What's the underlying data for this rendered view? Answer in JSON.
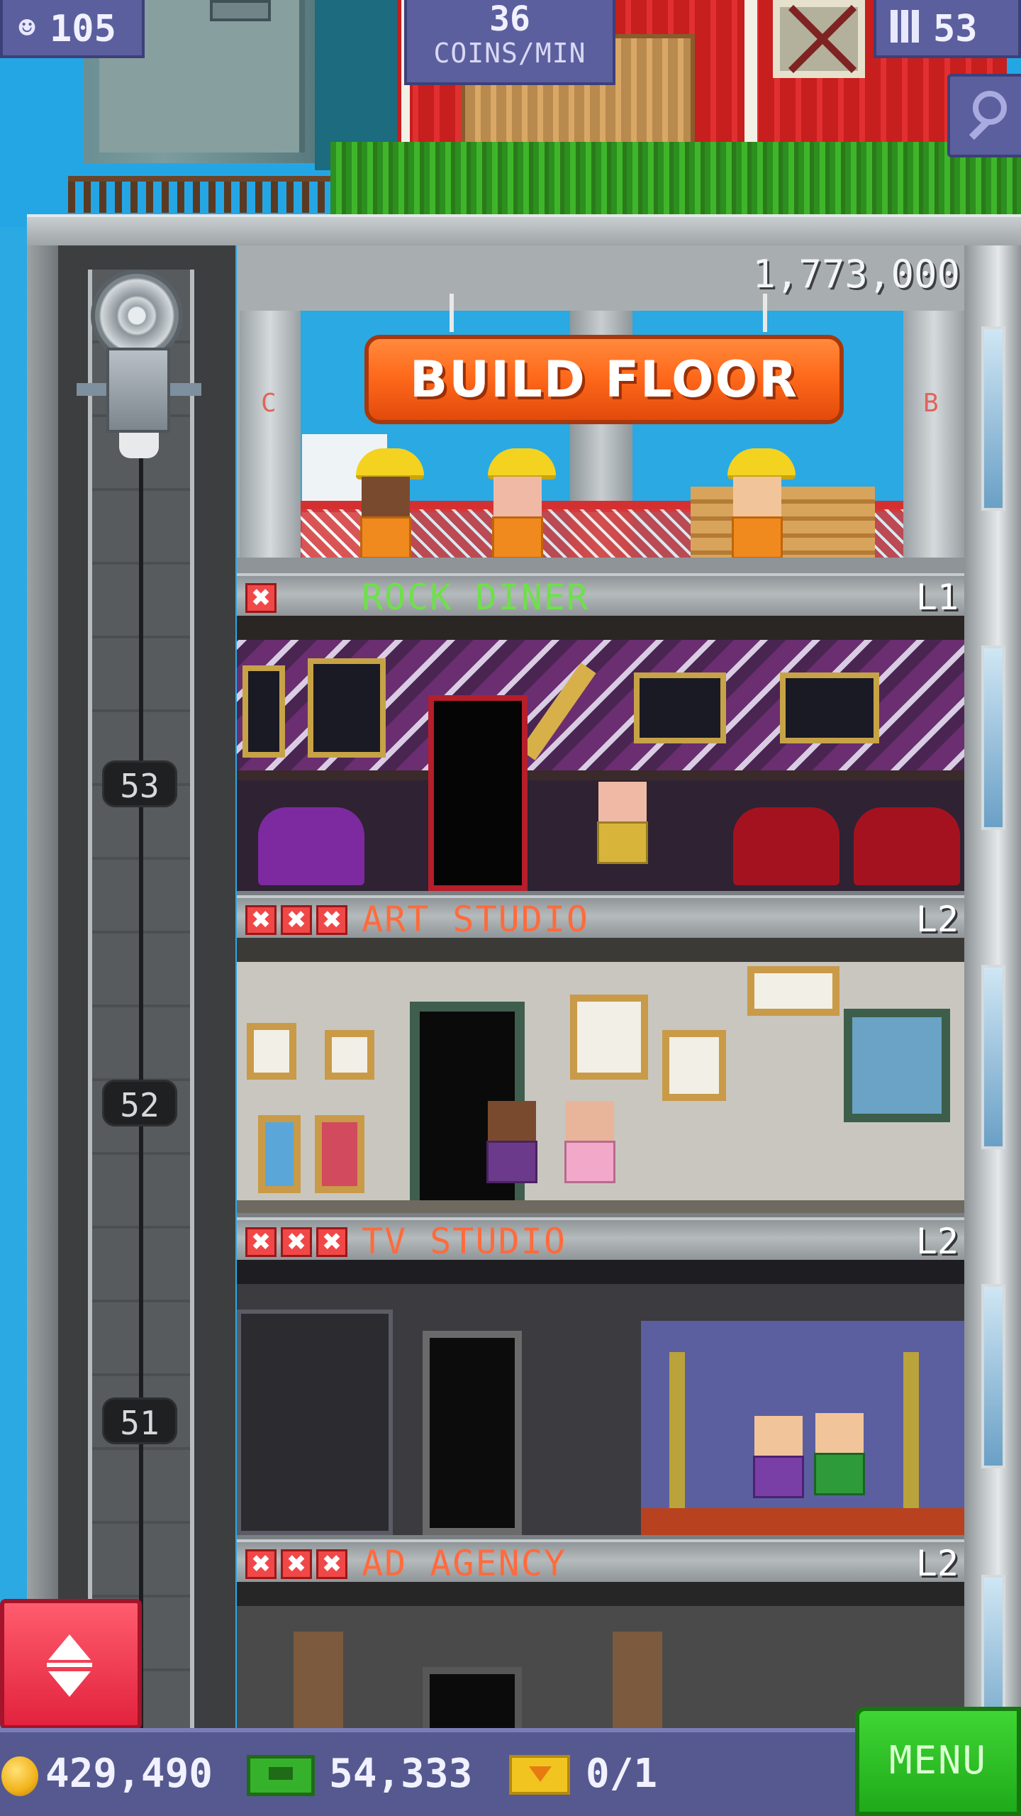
{
  "hud": {
    "population": "105",
    "rate_value": "36",
    "rate_label": "COINS/MIN",
    "floor_count": "53"
  },
  "build": {
    "price": "1,773,000",
    "button_label": "BUILD FLOOR",
    "pillar_left_mark": "C",
    "pillar_right_mark": "B"
  },
  "floors": [
    {
      "name": "ROCK DINER",
      "level": "L1",
      "stock_missing": 1,
      "color": "#6ee04a"
    },
    {
      "name": "ART STUDIO",
      "level": "L2",
      "stock_missing": 3,
      "color": "#ff6b3d"
    },
    {
      "name": "TV STUDIO",
      "level": "L2",
      "stock_missing": 3,
      "color": "#ff6b3d"
    },
    {
      "name": "AD AGENCY",
      "level": "L2",
      "stock_missing": 3,
      "color": "#ff6b3d"
    }
  ],
  "elevator": {
    "markers": [
      "53",
      "52",
      "51"
    ]
  },
  "bottom": {
    "coins": "429,490",
    "bux": "54,333",
    "tickets": "0/1",
    "menu_label": "MENU"
  },
  "icons": {
    "population": "person-icon",
    "floors": "building-icon",
    "search": "magnifier-icon",
    "coins": "coin-icon",
    "bux": "bux-icon",
    "tickets": "ticket-icon",
    "stock": "x-icon"
  },
  "colors": {
    "hud": "#5c5f9e",
    "build_button": "#ff6a1c",
    "menu": "#2cc125",
    "elevator_button": "#ee3048"
  }
}
